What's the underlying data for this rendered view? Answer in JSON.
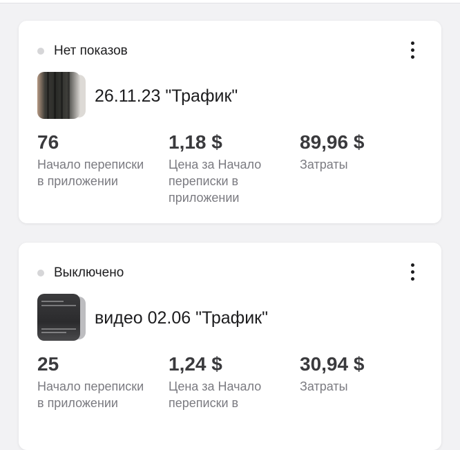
{
  "cards": [
    {
      "status": "Нет показов",
      "title": "26.11.23 \"Трафик\"",
      "metrics": [
        {
          "value": "76",
          "label": "Начало переписки в приложении"
        },
        {
          "value": "1,18 $",
          "label": "Цена за Начало переписки в приложении"
        },
        {
          "value": "89,96 $",
          "label": "Затраты"
        }
      ]
    },
    {
      "status": "Выключено",
      "title": "видео 02.06 \"Трафик\"",
      "metrics": [
        {
          "value": "25",
          "label": "Начало переписки в приложении"
        },
        {
          "value": "1,24 $",
          "label": "Цена за Начало переписки в"
        },
        {
          "value": "30,94 $",
          "label": "Затраты"
        }
      ]
    }
  ],
  "icons": {
    "menu": "more-vertical-icon",
    "status": "status-dot-icon"
  },
  "colors": {
    "status_dot": "#d6d6d8",
    "value_text": "#3a3a3d",
    "label_text": "#7a7a80"
  }
}
